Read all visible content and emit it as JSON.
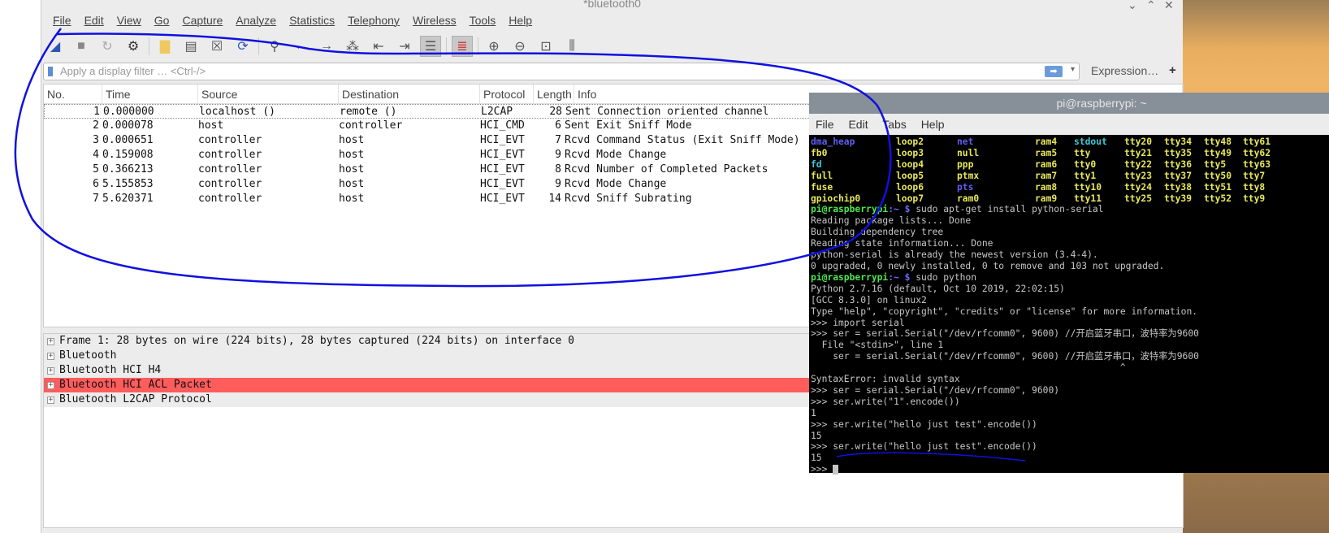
{
  "wireshark": {
    "title": "*bluetooth0",
    "menu": [
      "File",
      "Edit",
      "View",
      "Go",
      "Capture",
      "Analyze",
      "Statistics",
      "Telephony",
      "Wireless",
      "Tools",
      "Help"
    ],
    "filter_placeholder": "Apply a display filter … <Ctrl-/>",
    "expression_label": "Expression…",
    "add_label": "+",
    "columns": [
      "No.",
      "Time",
      "Source",
      "Destination",
      "Protocol",
      "Length",
      "Info"
    ],
    "packets": [
      [
        "1",
        "0.000000",
        "localhost ()",
        "remote ()",
        "L2CAP",
        "28",
        "Sent Connection oriented channel"
      ],
      [
        "2",
        "0.000078",
        "host",
        "controller",
        "HCI_CMD",
        "6",
        "Sent Exit Sniff Mode"
      ],
      [
        "3",
        "0.000651",
        "controller",
        "host",
        "HCI_EVT",
        "7",
        "Rcvd Command Status (Exit Sniff Mode)"
      ],
      [
        "4",
        "0.159008",
        "controller",
        "host",
        "HCI_EVT",
        "9",
        "Rcvd Mode Change"
      ],
      [
        "5",
        "0.366213",
        "controller",
        "host",
        "HCI_EVT",
        "8",
        "Rcvd Number of Completed Packets"
      ],
      [
        "6",
        "5.155853",
        "controller",
        "host",
        "HCI_EVT",
        "9",
        "Rcvd Mode Change"
      ],
      [
        "7",
        "5.620371",
        "controller",
        "host",
        "HCI_EVT",
        "14",
        "Rcvd Sniff Subrating"
      ]
    ],
    "details": [
      "Frame 1: 28 bytes on wire (224 bits), 28 bytes captured (224 bits) on interface 0",
      "Bluetooth",
      "Bluetooth HCI H4",
      "Bluetooth HCI ACL Packet",
      "Bluetooth L2CAP Protocol"
    ],
    "highlight_color": "#ff5c5c"
  },
  "terminal": {
    "title": "pi@raspberrypi: ~",
    "menu": [
      "File",
      "Edit",
      "Tabs",
      "Help"
    ],
    "ls_rows": [
      [
        "dma_heap",
        "loop2",
        "net",
        "ram4",
        "stdout",
        "tty20",
        "tty34",
        "tty48",
        "tty61"
      ],
      [
        "fb0",
        "loop3",
        "null",
        "ram5",
        "tty",
        "tty21",
        "tty35",
        "tty49",
        "tty62"
      ],
      [
        "fd",
        "loop4",
        "ppp",
        "ram6",
        "tty0",
        "tty22",
        "tty36",
        "tty5",
        "tty63"
      ],
      [
        "full",
        "loop5",
        "ptmx",
        "ram7",
        "tty1",
        "tty23",
        "tty37",
        "tty50",
        "tty7"
      ],
      [
        "fuse",
        "loop6",
        "pts",
        "ram8",
        "tty10",
        "tty24",
        "tty38",
        "tty51",
        "tty8"
      ],
      [
        "gpiochip0",
        "loop7",
        "ram0",
        "ram9",
        "tty11",
        "tty25",
        "tty39",
        "tty52",
        "tty9"
      ]
    ],
    "prompt_user": "pi@raspberrypi",
    "prompt_path": ":~ $",
    "cmd1": " sudo apt-get install python-serial",
    "out1": [
      "Reading package lists... Done",
      "Building dependency tree",
      "Reading state information... Done",
      "python-serial is already the newest version (3.4-4).",
      "0 upgraded, 0 newly installed, 0 to remove and 103 not upgraded."
    ],
    "cmd2": " sudo python",
    "out2": [
      "Python 2.7.16 (default, Oct 10 2019, 22:02:15)",
      "[GCC 8.3.0] on linux2",
      "Type \"help\", \"copyright\", \"credits\" or \"license\" for more information.",
      ">>> import serial",
      ">>> ser = serial.Serial(\"/dev/rfcomm0\", 9600) //开启蓝牙串口，波特率为9600",
      "  File \"<stdin>\", line 1",
      "    ser = serial.Serial(\"/dev/rfcomm0\", 9600) //开启蓝牙串口，波特率为9600",
      "                                                        ^",
      "SyntaxError: invalid syntax",
      ">>> ser = serial.Serial(\"/dev/rfcomm0\", 9600)",
      ">>> ser.write(\"1\".encode())",
      "1",
      ">>> ser.write(\"hello just test\".encode())",
      "15",
      ">>> ser.write(\"hello just test\".encode())",
      "15"
    ],
    "last_prompt": ">>> "
  }
}
